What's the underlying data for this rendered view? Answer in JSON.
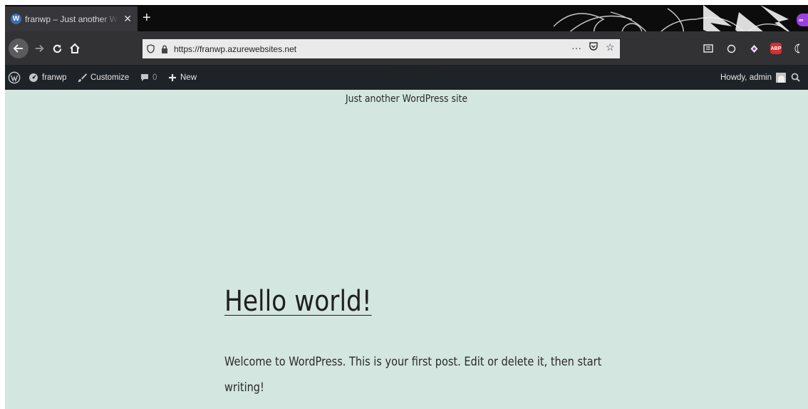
{
  "browser": {
    "tab": {
      "favicon": "wordpress-icon",
      "title": "franwp – Just another WordPress site"
    },
    "new_tab": "+",
    "url": "https://franwp.azurewebsites.net",
    "url_actions": [
      "more-icon",
      "pocket-icon",
      "bookmark-star-icon"
    ],
    "extensions": [
      "reader-icon",
      "extension-icon",
      "extension-icon",
      "adblock-plus-icon",
      "extension-icon"
    ],
    "abp_label": "ABP"
  },
  "admin_bar": {
    "site_name": "franwp",
    "customize": "Customize",
    "comments_count": "0",
    "new": "New",
    "howdy": "Howdy, admin"
  },
  "site": {
    "title": "FRANWP",
    "tagline": "Just another WordPress site"
  },
  "post": {
    "title": "Hello world!",
    "excerpt": "Welcome to WordPress. This is your first post. Edit or delete it, then start writing!"
  },
  "colors": {
    "page_background": "#d3e6df",
    "admin_bar": "#1d2327",
    "browser_chrome": "#323234"
  }
}
